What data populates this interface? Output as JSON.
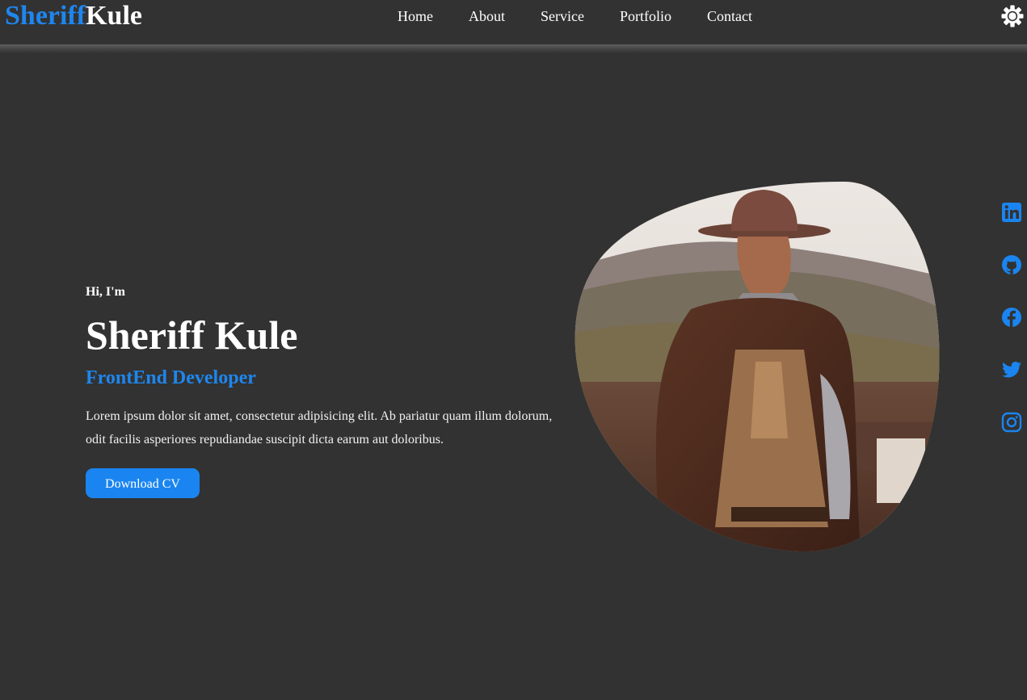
{
  "header": {
    "logo_first": "Sheriff",
    "logo_last": "Kule",
    "nav": [
      {
        "label": "Home"
      },
      {
        "label": "About"
      },
      {
        "label": "Service"
      },
      {
        "label": "Portfolio"
      },
      {
        "label": "Contact"
      }
    ],
    "theme_icon": "sun-gear-icon"
  },
  "hero": {
    "greeting": "Hi, I'm",
    "name": "Sheriff Kule",
    "role": "FrontEnd Developer",
    "description": "Lorem ipsum dolor sit amet, consectetur adipisicing elit. Ab pariatur quam illum dolorum, odit facilis asperiores repudiandae suscipit dicta earum aut doloribus.",
    "cv_button": "Download CV",
    "portrait_icon": "profile-photo"
  },
  "social": [
    {
      "name": "linkedin",
      "icon": "linkedin-icon"
    },
    {
      "name": "github",
      "icon": "github-icon"
    },
    {
      "name": "facebook",
      "icon": "facebook-icon"
    },
    {
      "name": "twitter",
      "icon": "twitter-icon"
    },
    {
      "name": "instagram",
      "icon": "instagram-icon"
    }
  ],
  "colors": {
    "background": "#323232",
    "accent": "#1e86ee",
    "text": "#ffffff"
  }
}
